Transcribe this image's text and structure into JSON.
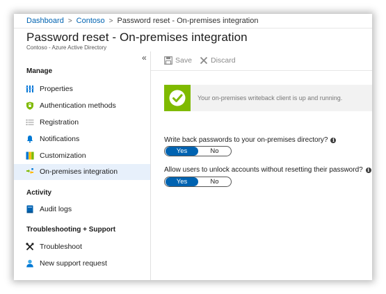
{
  "breadcrumb": {
    "items": [
      "Dashboard",
      "Contoso",
      "Password reset - On-premises integration"
    ],
    "separator": ">"
  },
  "header": {
    "title": "Password reset - On-premises integration",
    "subtitle": "Contoso - Azure Active Directory"
  },
  "sidebar": {
    "collapse_glyph": "«",
    "sections": {
      "manage": "Manage",
      "activity": "Activity",
      "troubleshooting": "Troubleshooting + Support"
    },
    "items": [
      {
        "label": "Properties",
        "icon": "properties-icon"
      },
      {
        "label": "Authentication methods",
        "icon": "shield-icon"
      },
      {
        "label": "Registration",
        "icon": "list-icon"
      },
      {
        "label": "Notifications",
        "icon": "bell-icon"
      },
      {
        "label": "Customization",
        "icon": "customization-icon"
      },
      {
        "label": "On-premises integration",
        "icon": "sync-icon",
        "selected": true
      },
      {
        "label": "Audit logs",
        "icon": "book-icon"
      },
      {
        "label": "Troubleshoot",
        "icon": "tools-icon"
      },
      {
        "label": "New support request",
        "icon": "person-icon"
      }
    ]
  },
  "toolbar": {
    "save_label": "Save",
    "discard_label": "Discard"
  },
  "status": {
    "message": "Your on-premises writeback client is up and running.",
    "color": "#7fba00"
  },
  "settings": {
    "writeback": {
      "question": "Write back passwords to your on-premises directory?",
      "yes": "Yes",
      "no": "No",
      "selected": "Yes"
    },
    "unlock": {
      "question": "Allow users to unlock accounts without resetting their password?",
      "yes": "Yes",
      "no": "No",
      "selected": "Yes"
    }
  },
  "colors": {
    "accent": "#0063b1",
    "selected_bg": "#e7f0fb"
  }
}
